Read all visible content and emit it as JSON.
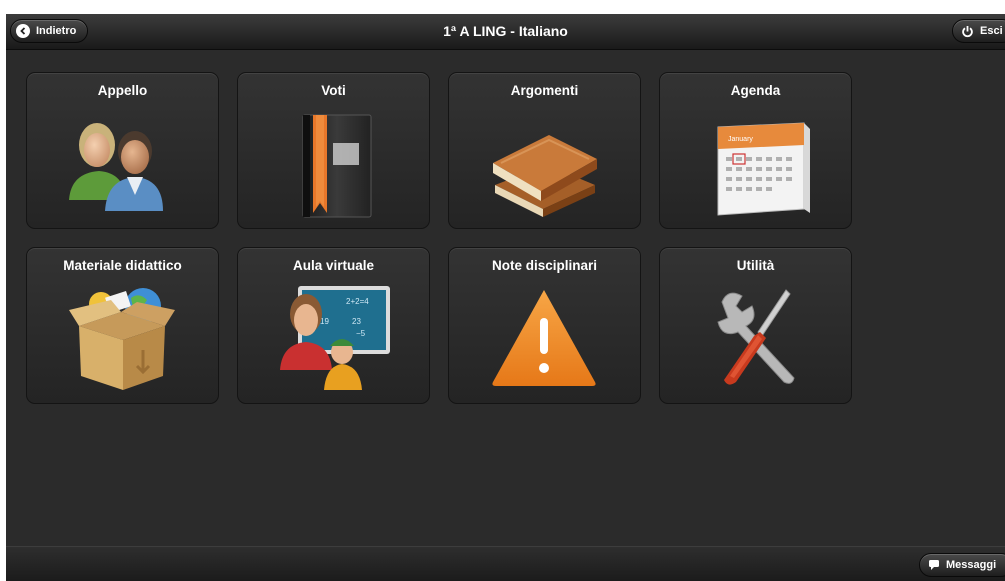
{
  "header": {
    "back_label": "Indietro",
    "title": "1ª A LING - Italiano",
    "exit_label": "Esci"
  },
  "tiles": [
    {
      "label": "Appello",
      "icon": "people-icon"
    },
    {
      "label": "Voti",
      "icon": "gradebook-icon"
    },
    {
      "label": "Argomenti",
      "icon": "books-icon"
    },
    {
      "label": "Agenda",
      "icon": "calendar-icon"
    },
    {
      "label": "Materiale didattico",
      "icon": "materials-box-icon"
    },
    {
      "label": "Aula virtuale",
      "icon": "virtual-classroom-icon"
    },
    {
      "label": "Note disciplinari",
      "icon": "warning-icon"
    },
    {
      "label": "Utilità",
      "icon": "tools-icon"
    }
  ],
  "calendar_month": "January",
  "board_text": [
    "2+2=4",
    "19",
    "23",
    "−5"
  ],
  "footer": {
    "messages_label": "Messaggi"
  }
}
